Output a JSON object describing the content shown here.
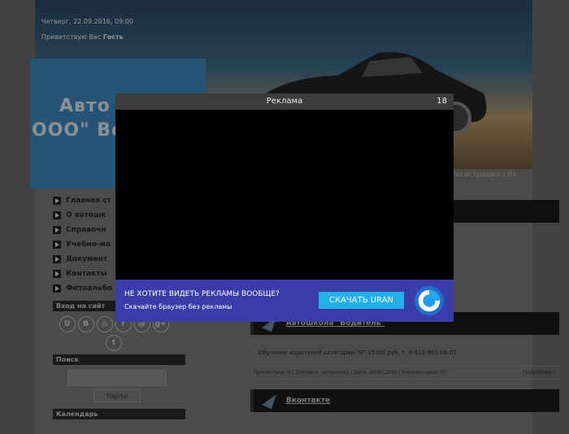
{
  "header": {
    "date": "Четверг, 22.09.2016, 09:00",
    "greeting_prefix": "Приветствую Вас",
    "greeting_user": "Гость",
    "logo_line1": "Авто",
    "logo_line2": "ООО\" Во",
    "top_right_links": "Регистрация | Вх"
  },
  "sidebar": {
    "nav": [
      {
        "label": "Главная ст"
      },
      {
        "label": "О автошк"
      },
      {
        "label": "Справочн"
      },
      {
        "label": "Учебно-ма"
      },
      {
        "label": "Документ"
      },
      {
        "label": "Контакты"
      },
      {
        "label": "Фотоальбо"
      }
    ],
    "login_title": "Вход на сайт",
    "social": [
      {
        "icon": "uid-icon",
        "glyph": "U"
      },
      {
        "icon": "vk-icon",
        "glyph": "В"
      },
      {
        "icon": "odnoklassniki-icon",
        "glyph": "◎"
      },
      {
        "icon": "facebook-icon",
        "glyph": "f"
      },
      {
        "icon": "mailru-icon",
        "glyph": "@"
      },
      {
        "icon": "googleplus-icon",
        "glyph": "g+"
      },
      {
        "icon": "twitter-icon",
        "glyph": "t"
      }
    ],
    "search_title": "Поиск",
    "search_button": "Найти",
    "calendar_title": "Календарь"
  },
  "content": {
    "posts": [
      {
        "title": "Автошкола \"Водитель\"",
        "text": "Обучение водителей категории \"В\"-15000 руб. т. 8-913-981-66-01",
        "meta_left": "Просмотров: 6 | Добавил: автошкола | Дата: 20.05.2016 | Комментарии (0)",
        "meta_right": "Подробнее »"
      },
      {
        "title": "Вконтакте"
      }
    ]
  },
  "ad": {
    "title": "Реклама",
    "countdown": "18",
    "headline": "НЕ ХОТИТЕ ВИДЕТЬ РЕКЛАМЫ ВООБЩЕ?",
    "subline": "Скачайте браузер без рекламы",
    "button": "СКАЧАТЬ URAN",
    "logo_icon": "uran-browser-icon"
  },
  "colors": {
    "ad_banner": "#3a3da8",
    "ad_button": "#23b0e8",
    "ad_bar": "#3c3c3c"
  }
}
